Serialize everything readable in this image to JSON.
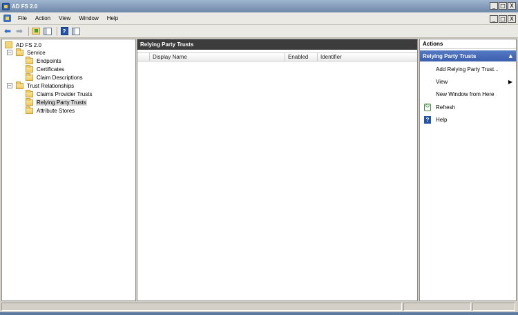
{
  "window": {
    "title": "AD FS 2.0",
    "controls": {
      "minimize": "_",
      "restore": "□",
      "close": "X"
    }
  },
  "menubar": {
    "items": [
      "File",
      "Action",
      "View",
      "Window",
      "Help"
    ],
    "controls": {
      "minimize": "_",
      "restore": "□",
      "close": "X"
    }
  },
  "toolbar": {
    "icons": [
      "back-arrow-icon",
      "forward-arrow-icon",
      "up-folder-icon",
      "show-hide-tree-icon",
      "help-icon",
      "show-hide-action-pane-icon"
    ]
  },
  "tree": {
    "root": "AD FS 2.0",
    "service": {
      "label": "Service",
      "expander": "−",
      "children": [
        "Endpoints",
        "Certificates",
        "Claim Descriptions"
      ]
    },
    "trust": {
      "label": "Trust Relationships",
      "expander": "−",
      "children": [
        "Claims Provider Trusts",
        "Relying Party Trusts",
        "Attribute Stores"
      ],
      "selected": "Relying Party Trusts"
    }
  },
  "center": {
    "header": "Relying Party Trusts",
    "columns": [
      "Display Name",
      "Enabled",
      "Identifier"
    ],
    "rows": []
  },
  "actions": {
    "title": "Actions",
    "section": "Relying Party Trusts",
    "section_caret": "▲",
    "items": [
      {
        "label": "Add Relying Party Trust...",
        "icon": ""
      },
      {
        "label": "View",
        "icon": "",
        "submenu": "▶"
      },
      {
        "label": "New Window from Here",
        "icon": ""
      },
      {
        "label": "Refresh",
        "icon": "refresh-icon"
      },
      {
        "label": "Help",
        "icon": "help-icon",
        "icon_text": "?"
      }
    ]
  },
  "colors": {
    "title_bar": "#6e87a8",
    "pane_header": "#3c3c3c",
    "actions_section": "#3c5fae",
    "selection": "#d9d9d9"
  }
}
